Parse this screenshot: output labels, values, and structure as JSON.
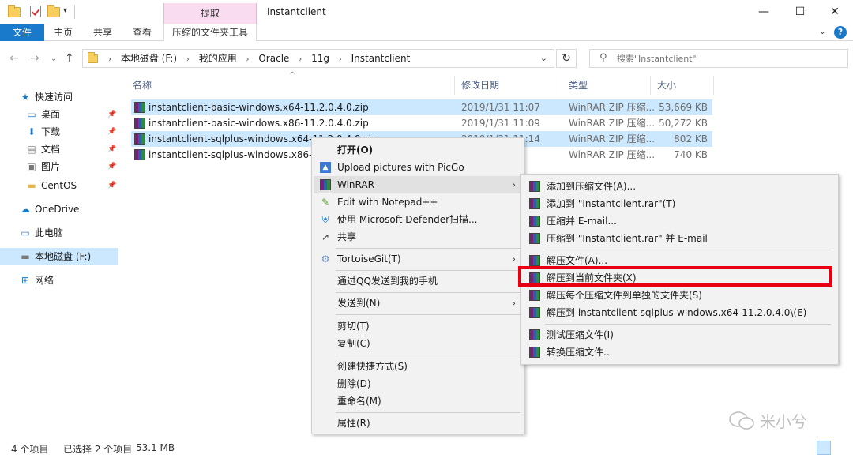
{
  "window": {
    "title": "Instantclient",
    "context_tab_head": "提取",
    "minimize": "—",
    "maximize": "☐",
    "close": "✕"
  },
  "ribbon": {
    "tabs": [
      "文件",
      "主页",
      "共享",
      "查看"
    ],
    "context_tab": "压缩的文件夹工具",
    "expand": "⌄",
    "help": "?"
  },
  "address": {
    "crumbs": [
      "本地磁盘 (F:)",
      "我的应用",
      "Oracle",
      "11g",
      "Instantclient"
    ],
    "search_placeholder": "搜索\"Instantclient\""
  },
  "sidebar": {
    "items": [
      {
        "label": "快速访问",
        "icon": "star-icon",
        "glyph": "★",
        "pinned": false
      },
      {
        "label": "桌面",
        "icon": "desktop-icon",
        "glyph": "▭",
        "pinned": true
      },
      {
        "label": "下载",
        "icon": "download-icon",
        "glyph": "⬇",
        "pinned": true
      },
      {
        "label": "文档",
        "icon": "document-icon",
        "glyph": "▤",
        "pinned": true
      },
      {
        "label": "图片",
        "icon": "picture-icon",
        "glyph": "▣",
        "pinned": true
      },
      {
        "label": "CentOS",
        "icon": "folder-icon",
        "glyph": "▬",
        "pinned": true
      },
      {
        "label": "OneDrive",
        "icon": "cloud-icon",
        "glyph": "☁",
        "pinned": false
      },
      {
        "label": "此电脑",
        "icon": "computer-icon",
        "glyph": "▭",
        "pinned": false
      },
      {
        "label": "本地磁盘 (F:)",
        "icon": "drive-icon",
        "glyph": "▬",
        "pinned": false
      },
      {
        "label": "网络",
        "icon": "network-icon",
        "glyph": "⊞",
        "pinned": false
      }
    ],
    "selected_label": "本地磁盘 (F:)"
  },
  "columns": {
    "name": "名称",
    "date": "修改日期",
    "type": "类型",
    "size": "大小"
  },
  "files": [
    {
      "name": "instantclient-basic-windows.x64-11.2.0.4.0.zip",
      "date": "2019/1/31 11:07",
      "type": "WinRAR ZIP 压缩...",
      "size": "53,669 KB",
      "selected": true
    },
    {
      "name": "instantclient-basic-windows.x86-11.2.0.4.0.zip",
      "date": "2019/1/31 11:09",
      "type": "WinRAR ZIP 压缩...",
      "size": "50,272 KB",
      "selected": false
    },
    {
      "name": "instantclient-sqlplus-windows.x64-11.2.0.4.0.zip",
      "date": "2019/1/31 11:14",
      "type": "WinRAR ZIP 压缩...",
      "size": "802 KB",
      "selected": true
    },
    {
      "name": "instantclient-sqlplus-windows.x86-11.2.0.4.0.zip",
      "date": "",
      "type": "WinRAR ZIP 压缩...",
      "size": "740 KB",
      "selected": false
    }
  ],
  "context_menu": {
    "open": "打开(O)",
    "upload": "Upload pictures with PicGo",
    "winrar": "WinRAR",
    "notepad": "Edit with Notepad++",
    "defender": "使用 Microsoft Defender扫描...",
    "share": "共享",
    "tortoise": "TortoiseGit(T)",
    "qq": "通过QQ发送到我的手机",
    "sendto": "发送到(N)",
    "cut": "剪切(T)",
    "copy": "复制(C)",
    "shortcut": "创建快捷方式(S)",
    "delete": "删除(D)",
    "rename": "重命名(M)",
    "properties": "属性(R)",
    "arrow": "›"
  },
  "winrar_submenu": {
    "items": [
      "添加到压缩文件(A)...",
      "添加到 \"Instantclient.rar\"(T)",
      "压缩并 E-mail...",
      "压缩到 \"Instantclient.rar\" 并 E-mail",
      "解压文件(A)...",
      "解压到当前文件夹(X)",
      "解压每个压缩文件到单独的文件夹(S)",
      "解压到 instantclient-sqlplus-windows.x64-11.2.0.4.0\\(E)",
      "测试压缩文件(I)",
      "转换压缩文件..."
    ],
    "highlight_color": "#e60012"
  },
  "status": {
    "count": "4 个项目",
    "selected": "已选择 2 个项目",
    "size": "53.1 MB"
  },
  "watermark": "米小兮",
  "colors": {
    "accent": "#1979ca",
    "selection": "#cce8ff",
    "context_tab": "#fadcf0"
  }
}
